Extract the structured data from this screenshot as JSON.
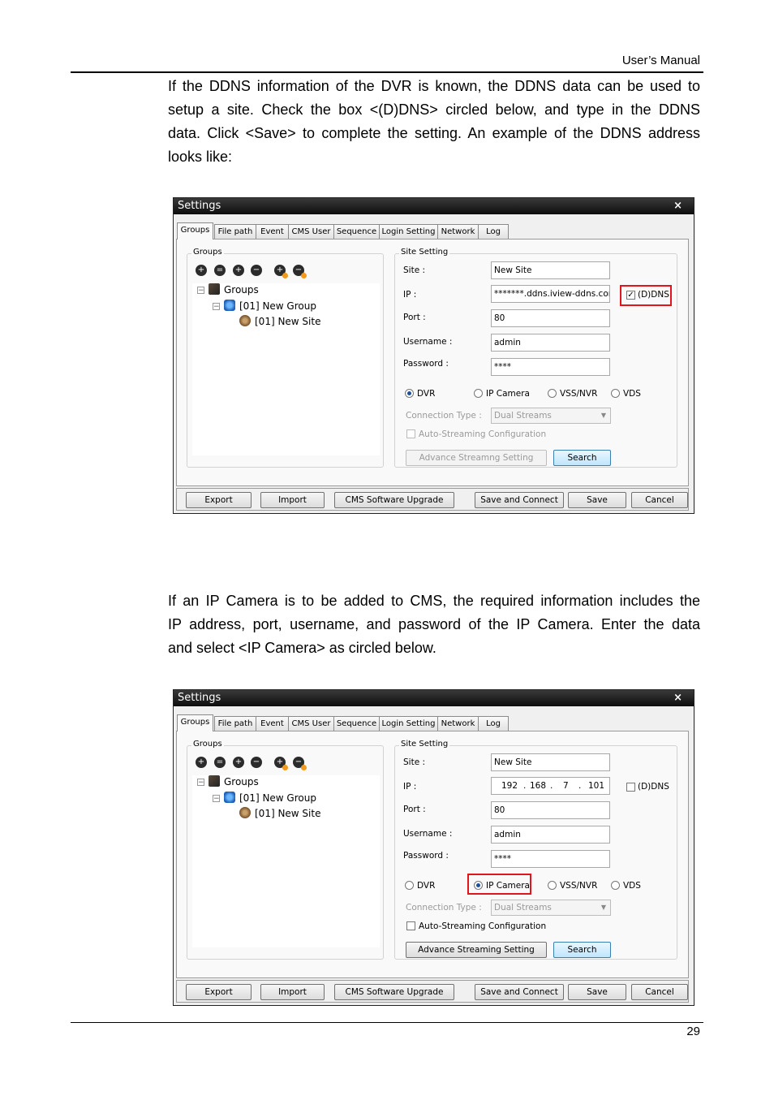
{
  "header": {
    "title": "User’s Manual"
  },
  "page_number": "29",
  "para1": {
    "lines": [
      "If the DDNS information of the DVR is known, the DDNS data can be used to",
      "setup a site. Check the box <(D)DNS> circled below, and type in the DDNS",
      "data. Click <Save> to complete the setting. An example of the DDNS address",
      "looks like:"
    ]
  },
  "para2": {
    "lines": [
      "If an IP Camera is to be added to CMS, the required information includes the",
      "IP address, port, username, and password of the IP Camera. Enter the data",
      "and select <IP Camera> as circled below."
    ]
  },
  "dialog_common": {
    "title": "Settings",
    "close": "×",
    "tabs": [
      "Groups",
      "File path",
      "Event",
      "CMS User",
      "Sequence",
      "Login Setting",
      "Network",
      "Log"
    ],
    "groups_box_title": "Groups",
    "site_box_title": "Site Setting",
    "tree": {
      "root": "Groups",
      "group": "[01] New Group",
      "site": "[01] New Site"
    },
    "labels": {
      "site": "Site :",
      "ip": "IP :",
      "port": "Port :",
      "username": "Username :",
      "password": "Password :",
      "ddns": "(D)DNS",
      "connection_type": "Connection Type :",
      "auto_streaming": "Auto-Streaming Configuration",
      "advance_streaming": "Advance Streaming Setting",
      "advance_streaming_disabled": "Advance Streamng Setting",
      "search": "Search"
    },
    "radios": [
      "DVR",
      "IP Camera",
      "VSS/NVR",
      "VDS"
    ],
    "bottom_buttons": [
      "Export",
      "Import",
      "CMS Software Upgrade",
      "Save and Connect",
      "Save",
      "Cancel"
    ]
  },
  "dialog1": {
    "site_value": "New Site",
    "ip_value": "*******.ddns.iview-ddns.com",
    "port_value": "80",
    "username_value": "admin",
    "password_value": "****",
    "ddns_checked": true,
    "selected_radio": "DVR",
    "connection_type_value": "Dual Streams"
  },
  "dialog2": {
    "site_value": "New Site",
    "ip_octets": [
      "192",
      "168",
      "7",
      "101"
    ],
    "port_value": "80",
    "username_value": "admin",
    "password_value": "****",
    "ddns_checked": false,
    "selected_radio": "IP Camera",
    "connection_type_value": "Dual Streams"
  },
  "colors": {
    "highlight_box": "#e2141c",
    "titlebar": "#111111"
  }
}
